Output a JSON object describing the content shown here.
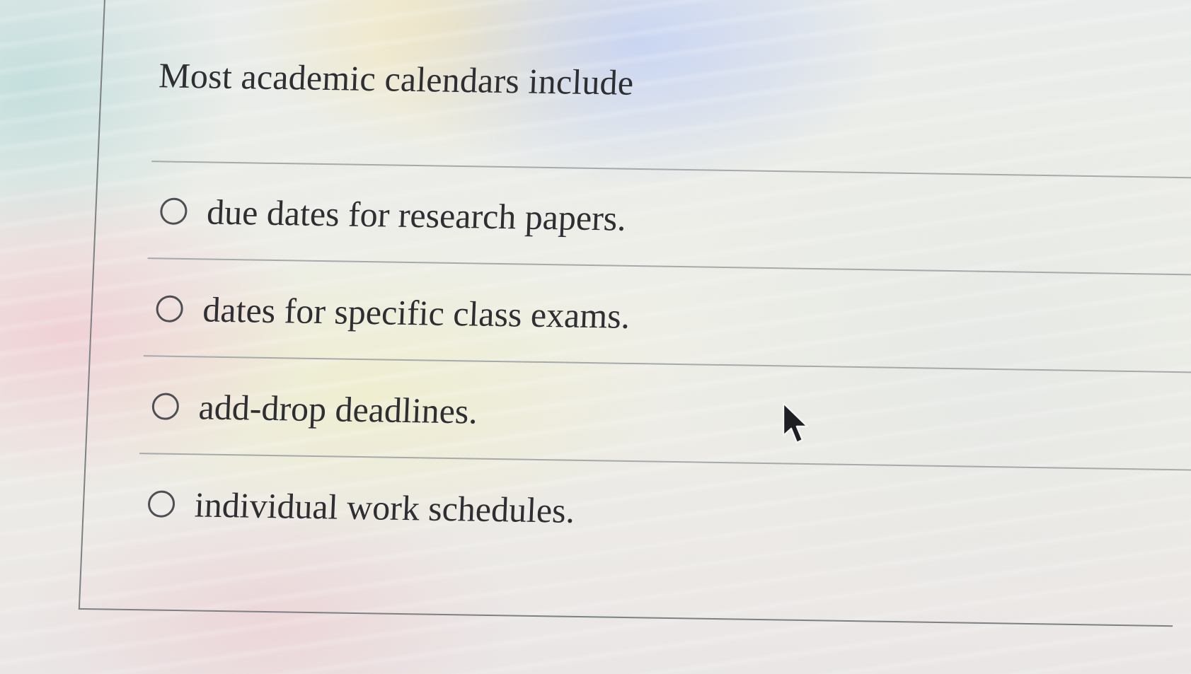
{
  "question": {
    "prompt": "Most academic calendars include"
  },
  "options": [
    {
      "label": "due dates for research papers.",
      "selected": false
    },
    {
      "label": "dates for specific class exams.",
      "selected": false
    },
    {
      "label": "add-drop deadlines.",
      "selected": false
    },
    {
      "label": "individual work schedules.",
      "selected": false
    }
  ],
  "icons": {
    "radio": "radio-button-empty-icon",
    "pointer": "mouse-cursor-arrow-icon"
  }
}
